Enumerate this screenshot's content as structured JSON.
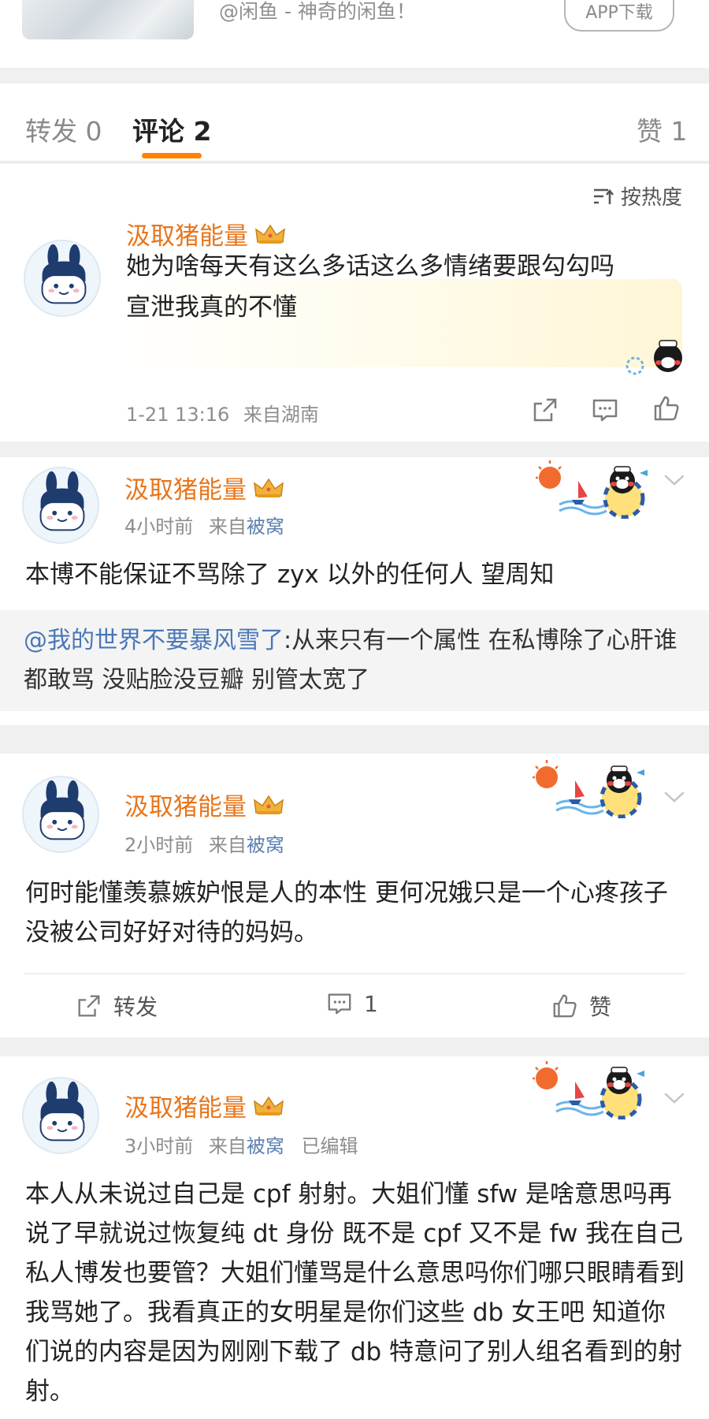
{
  "ad": {
    "text": "@闲鱼 - 神奇的闲鱼！",
    "button_label": "APP下载"
  },
  "tabs": {
    "repost": "转发 0",
    "comment": "评论 2",
    "like": "赞 1"
  },
  "sort": {
    "label": "按热度"
  },
  "comment": {
    "username": "汲取猪能量",
    "text_line1": "她为啥每天有这么多话这么多情绪要跟勾勾吗",
    "text_line2": "宣泄我真的不懂",
    "time": "1-21 13:16",
    "source": "来自湖南"
  },
  "posts": [
    {
      "username": "汲取猪能量",
      "time": "4小时前",
      "source_prefix": "来自",
      "source_link": "被窝",
      "body": "本博不能保证不骂除了 zyx 以外的任何人 望周知",
      "quote_at": "@我的世界不要暴风雪了",
      "quote_text": ":从来只有一个属性 在私博除了心肝谁都敢骂 没贴脸没豆瓣 别管太宽了"
    },
    {
      "username": "汲取猪能量",
      "time": "2小时前",
      "source_prefix": "来自",
      "source_link": "被窝",
      "body": "何时能懂羡慕嫉妒恨是人的本性 更何况娥只是一个心疼孩子没被公司好好对待的妈妈。",
      "repost_label": "转发",
      "comment_count": "1",
      "like_label": "赞"
    },
    {
      "username": "汲取猪能量",
      "time": "3小时前",
      "source_prefix": "来自",
      "source_link": "被窝",
      "edited": "已编辑",
      "body": "本人从未说过自己是 cpf 射射。大姐们懂 sfw 是啥意思吗再说了早就说过恢复纯 dt 身份 既不是 cpf 又不是 fw 我在自己私人博发也要管？大姐们懂骂是什么意思吗你们哪只眼睛看到我骂她了。我看真正的女明星是你们这些 db 女王吧 知道你们说的内容是因为刚刚下载了 db 特意问了别人组名看到的射射。"
    }
  ],
  "colors": {
    "accent": "#ff8200",
    "username": "#e8761c",
    "link": "#4a77b8"
  }
}
